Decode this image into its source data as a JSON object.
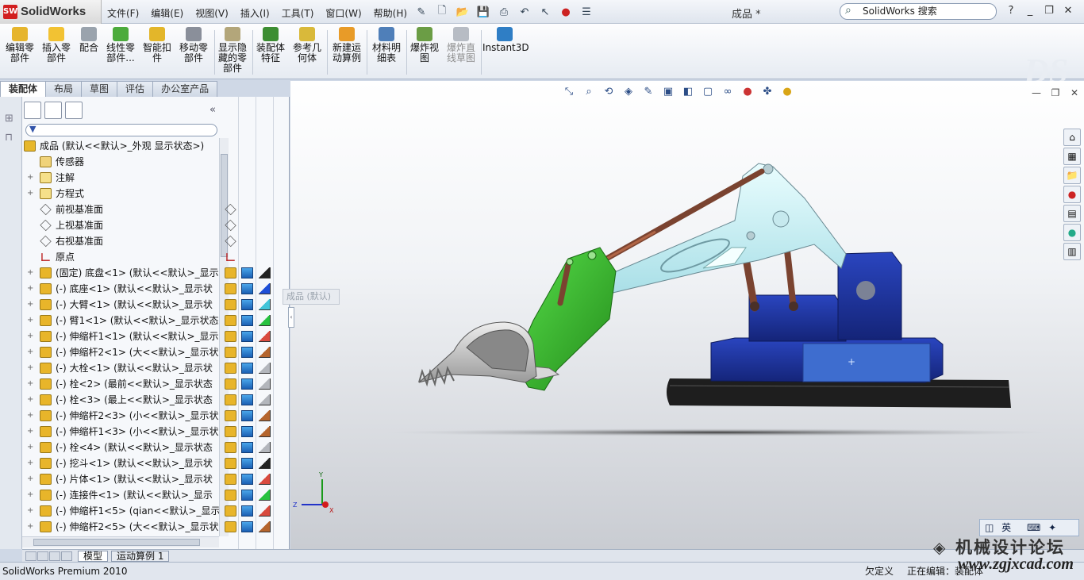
{
  "app": {
    "brand": "SolidWorks",
    "document_title": "成品 *",
    "search_placeholder": "SolidWorks 搜索",
    "help_icon": "?",
    "status_product": "SolidWorks Premium 2010",
    "status_undef": "欠定义",
    "status_editing": "正在编辑：装配体"
  },
  "menu": [
    "文件(F)",
    "编辑(E)",
    "视图(V)",
    "插入(I)",
    "工具(T)",
    "窗口(W)",
    "帮助(H)"
  ],
  "commands": [
    {
      "label": "编辑零部件",
      "color": "#e6b52e"
    },
    {
      "label": "插入零部件",
      "color": "#f2c233"
    },
    {
      "label": "配合",
      "color": "#9aa3ad"
    },
    {
      "label": "线性零部件...",
      "color": "#4cab3c"
    },
    {
      "label": "智能扣件",
      "color": "#e3b62a"
    },
    {
      "label": "移动零部件",
      "color": "#8a8f9a"
    },
    {
      "label": "显示隐藏的零部件",
      "color": "#b3a67a"
    },
    {
      "label": "装配体特征",
      "color": "#3d8e33"
    },
    {
      "label": "参考几何体",
      "color": "#d9b93a"
    },
    {
      "label": "新建运动算例",
      "color": "#e89b28"
    },
    {
      "label": "材料明细表",
      "color": "#4f7fb9"
    },
    {
      "label": "爆炸视图",
      "color": "#6b9d45"
    },
    {
      "label": "爆炸直线草图",
      "color": "#b7bcc4"
    },
    {
      "label": "Instant3D",
      "color": "#2f7ec5"
    }
  ],
  "cmd_tabs": [
    "装配体",
    "布局",
    "草图",
    "评估",
    "办公室产品"
  ],
  "tree": {
    "root": "成品  (默认<<默认>_外观 显示状态>)",
    "items": [
      {
        "label": "传感器",
        "icon": "sensor-icon"
      },
      {
        "label": "注解",
        "icon": "annotation-icon"
      },
      {
        "label": "方程式",
        "icon": "equation-icon"
      },
      {
        "label": "前视基准面",
        "icon": "plane-icon"
      },
      {
        "label": "上视基准面",
        "icon": "plane-icon"
      },
      {
        "label": "右视基准面",
        "icon": "plane-icon"
      },
      {
        "label": "原点",
        "icon": "origin-icon"
      },
      {
        "label": "(固定) 底盘<1> (默认<<默认>_显示",
        "icon": "part-icon"
      },
      {
        "label": "(-) 底座<1> (默认<<默认>_显示状",
        "icon": "part-icon"
      },
      {
        "label": "(-) 大臂<1> (默认<<默认>_显示状",
        "icon": "part-icon"
      },
      {
        "label": "(-) 臂1<1> (默认<<默认>_显示状态",
        "icon": "part-icon"
      },
      {
        "label": "(-) 伸缩杆1<1> (默认<<默认>_显示",
        "icon": "part-icon"
      },
      {
        "label": "(-) 伸缩杆2<1> (大<<默认>_显示状",
        "icon": "part-icon"
      },
      {
        "label": "(-) 大栓<1> (默认<<默认>_显示状",
        "icon": "part-icon"
      },
      {
        "label": "(-) 栓<2> (最前<<默认>_显示状态",
        "icon": "part-icon"
      },
      {
        "label": "(-) 栓<3> (最上<<默认>_显示状态",
        "icon": "part-icon"
      },
      {
        "label": "(-) 伸缩杆2<3> (小<<默认>_显示状",
        "icon": "part-icon"
      },
      {
        "label": "(-) 伸缩杆1<3> (小<<默认>_显示状",
        "icon": "part-icon"
      },
      {
        "label": "(-) 栓<4> (默认<<默认>_显示状态",
        "icon": "part-icon"
      },
      {
        "label": "(-) 挖斗<1> (默认<<默认>_显示状",
        "icon": "part-icon"
      },
      {
        "label": "(-) 片体<1> (默认<<默认>_显示状",
        "icon": "part-icon"
      },
      {
        "label": "(-) 连接件<1> (默认<<默认>_显示",
        "icon": "part-icon"
      },
      {
        "label": "(-) 伸缩杆1<5> (qian<<默认>_显示",
        "icon": "part-icon"
      },
      {
        "label": "(-) 伸缩杆2<5> (大<<默认>_显示状",
        "icon": "part-icon"
      }
    ],
    "appearance_colors": [
      "#222222",
      "#1e4fd8",
      "#41c4d9",
      "#27c23f",
      "#d94a3e",
      "#b5652d",
      "#b3b6bc",
      "#b3b6bc",
      "#b3b6bc",
      "#b5652d",
      "#b5652d",
      "#b3b6bc",
      "#222222",
      "#d94a3e",
      "#27c23f",
      "#d94a3e",
      "#b5652d"
    ]
  },
  "viewport": {
    "tooltip": "成品 (默认)",
    "triad": {
      "x": "X",
      "y": "Y",
      "z": "Z"
    }
  },
  "bottom_tabs": [
    "模型",
    "运动算例 1"
  ],
  "ime": {
    "lang": "英"
  },
  "watermark": {
    "title": "机械设计论坛",
    "url": "www.zgjxcad.com"
  },
  "colors": {
    "boom": "#cdf4f6",
    "arm": "#37c12c",
    "bucket": "#c7c7c7",
    "base": "#1b2f9b",
    "base_front": "#3e6dcf",
    "track": "#1e1e1e",
    "cylinder": "#7a4330"
  }
}
